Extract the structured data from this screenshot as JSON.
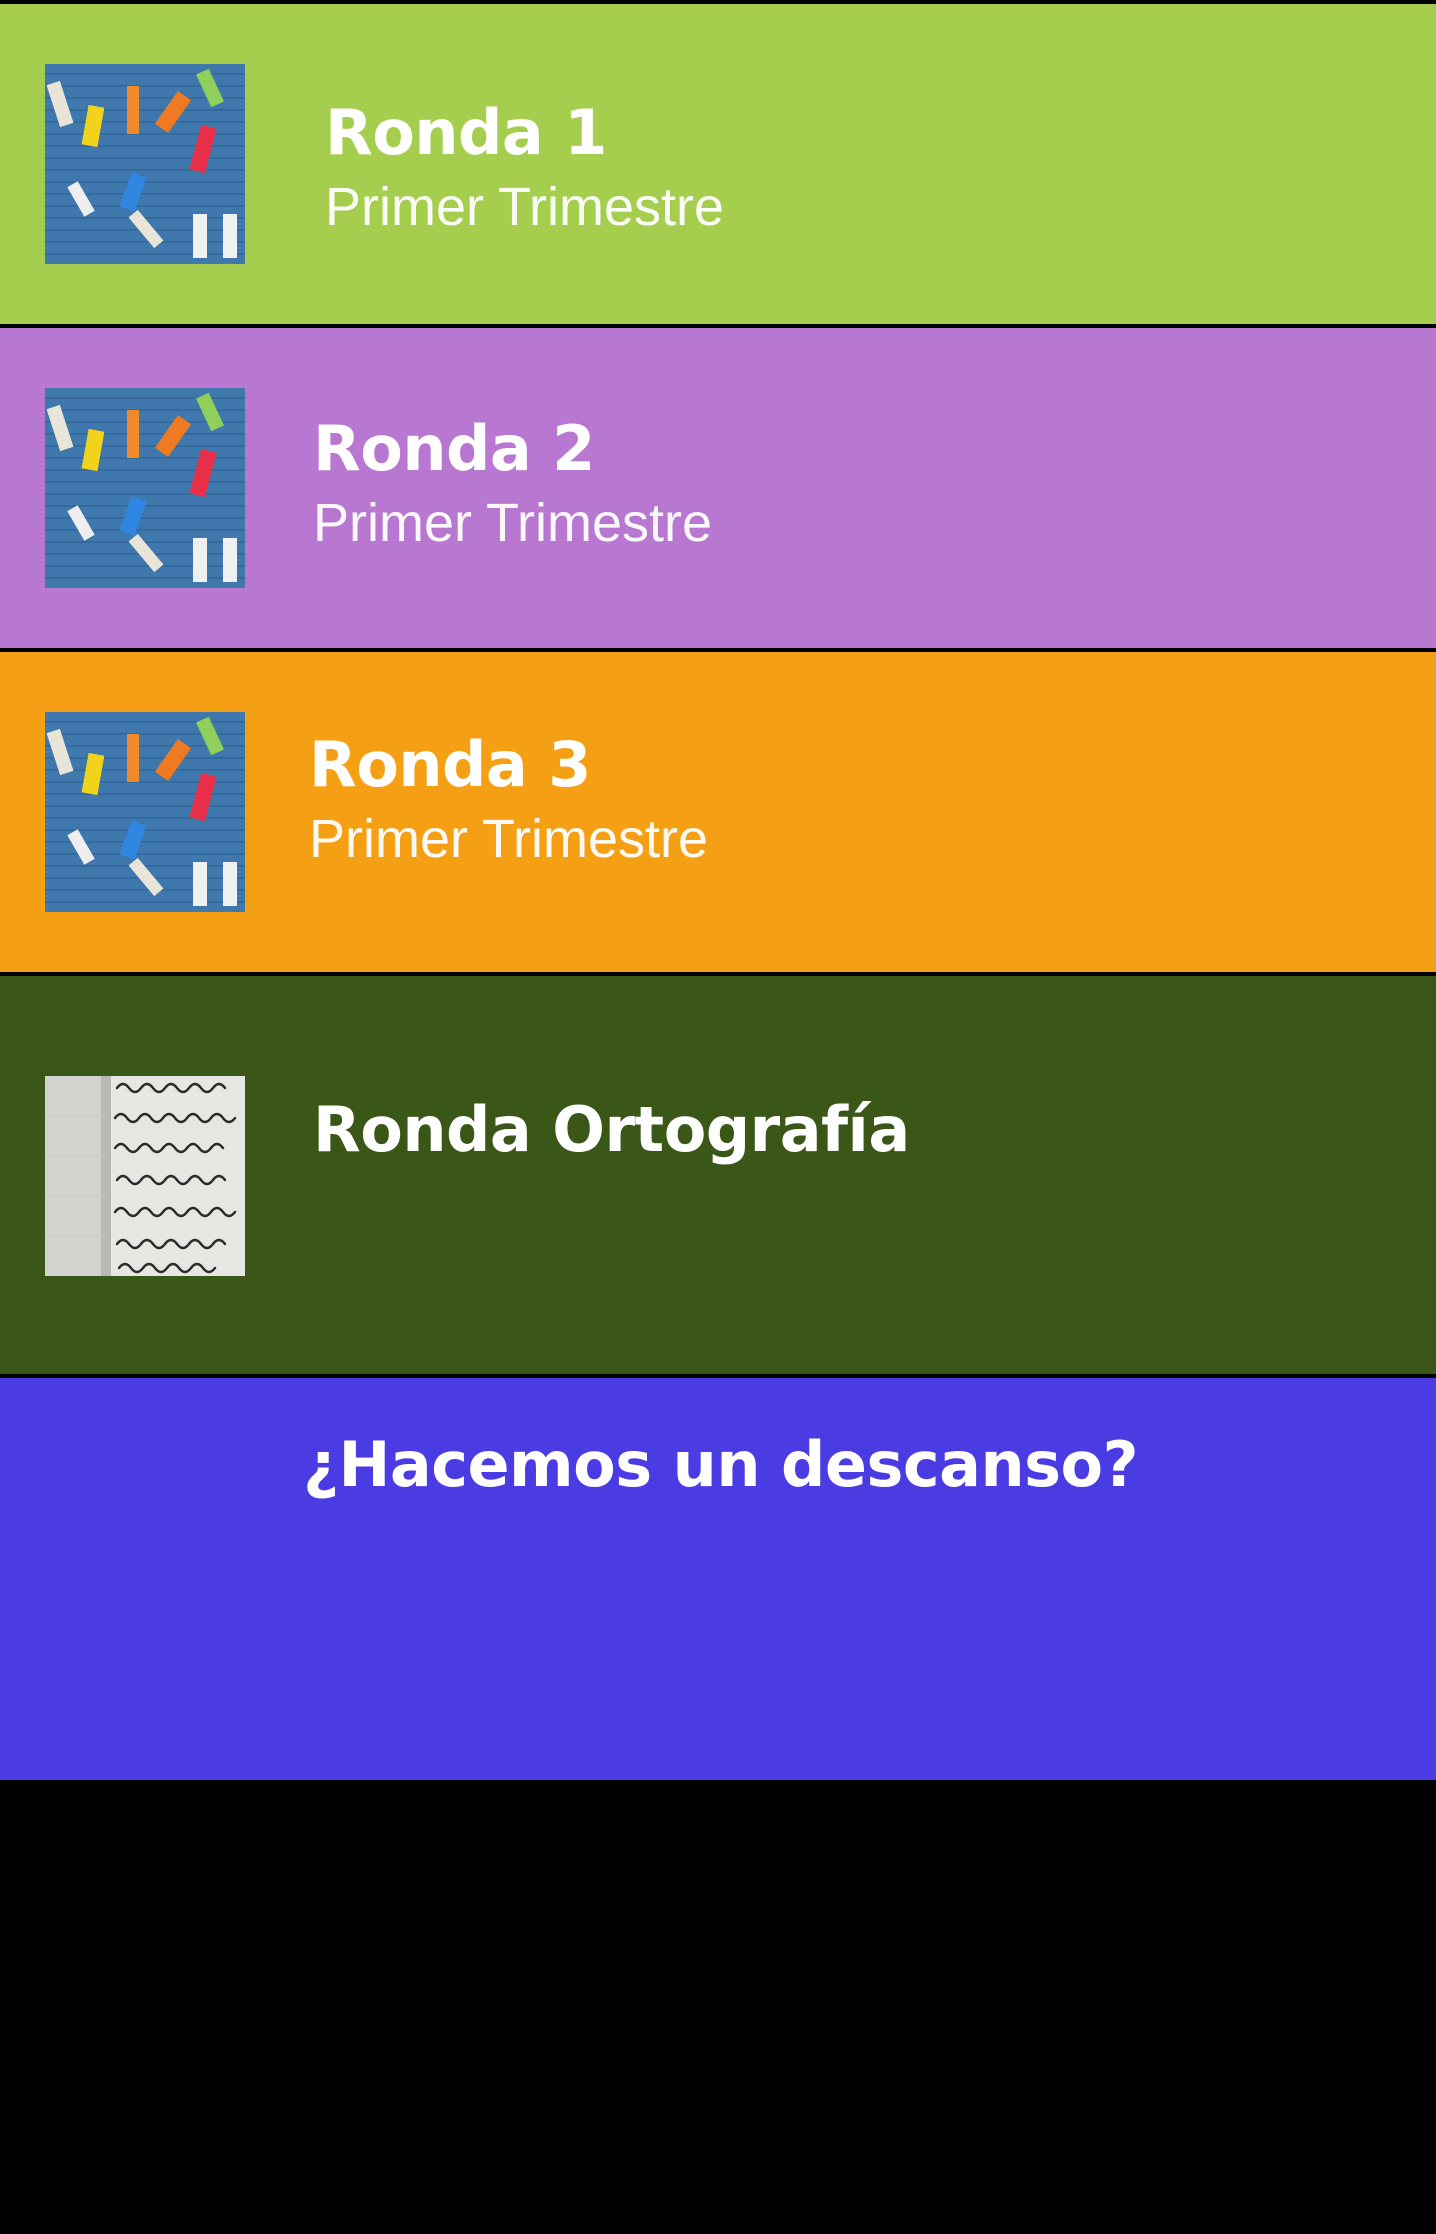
{
  "colors": {
    "background": "#000000",
    "separator": "#ffffff",
    "text": "#ffffff"
  },
  "cards": [
    {
      "title": "Ronda 1",
      "subtitle": "Primer Trimestre",
      "color": "#a5ce4f",
      "thumbnail": "alphabet-letters-image"
    },
    {
      "title": "Ronda 2",
      "subtitle": "Primer Trimestre",
      "color": "#b877d0",
      "thumbnail": "alphabet-letters-image"
    },
    {
      "title": "Ronda 3",
      "subtitle": "Primer Trimestre",
      "color": "#f5a014",
      "thumbnail": "alphabet-letters-image"
    },
    {
      "title": "Ronda Ortografía",
      "color": "#3a5718",
      "thumbnail": "handwriting-notebook-image"
    },
    {
      "title": "¿Hacemos un descanso?",
      "color": "#4a3be2"
    }
  ]
}
